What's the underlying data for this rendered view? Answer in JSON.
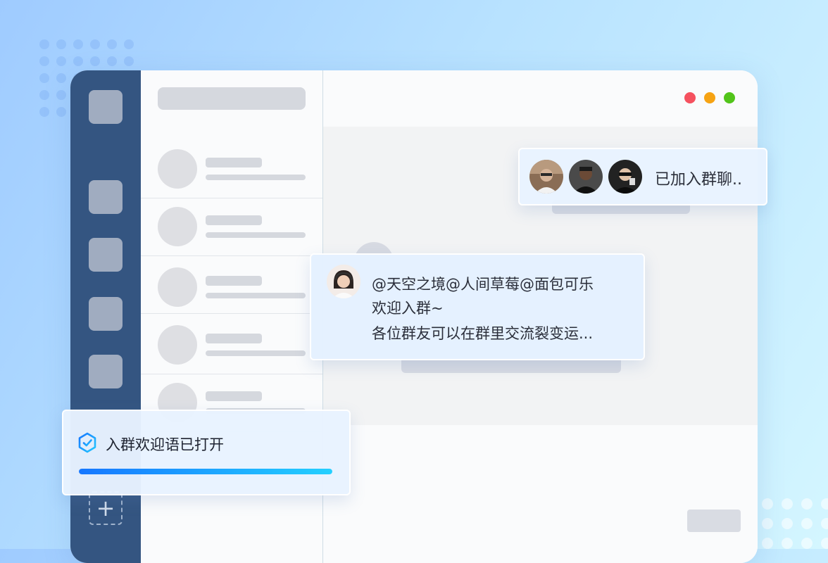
{
  "window_controls": {
    "close_color": "#f5515f",
    "minimize_color": "#f6a313",
    "maximize_color": "#52c41a"
  },
  "joined_notice": {
    "text": "已加入群聊..",
    "avatars": [
      "member-avatar-1",
      "member-avatar-2",
      "member-avatar-3"
    ]
  },
  "welcome_message": {
    "lines": [
      "@天空之境@人间草莓@面包可乐",
      "欢迎入群~",
      "各位群友可以在群里交流裂变运..."
    ]
  },
  "toast": {
    "text": "入群欢迎语已打开",
    "progress": 1.0
  },
  "nav": {
    "add_label": "+"
  }
}
